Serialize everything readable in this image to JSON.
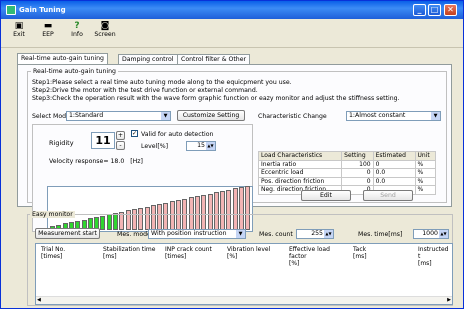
{
  "window": {
    "title": "Gain Tuning",
    "min": "_",
    "max": "□",
    "close": "✕"
  },
  "toolbar": [
    {
      "label": "Exit",
      "icon": "exit-icon"
    },
    {
      "label": "EEP",
      "icon": "eep-icon"
    },
    {
      "label": "Info",
      "icon": "help-icon"
    },
    {
      "label": "Screen",
      "icon": "camera-icon"
    }
  ],
  "tabs": [
    "Real-time auto-gain tuning",
    "Damping control",
    "Control filter & Other"
  ],
  "rt": {
    "group_title": "Real-time auto-gain tuning",
    "step1": "Step1:Please select a real time auto tuning mode along to the equicpment you use.",
    "step2": "Step2:Drive the motor with the test drive function or external command.",
    "step3": "Step3:Check the operation result with the wave form graphic function or eazy monitor and adjust the stiffness setting.",
    "select_mode_label": "Select Mode",
    "select_mode_value": "1:Standard",
    "customize_button": "Customize Setting",
    "char_change_label": "Characteristic Change",
    "char_change_value": "1:Almost constant",
    "rigidity_label": "Rigidity",
    "rigidity_value": "11",
    "plus": "+",
    "minus": "-",
    "valid_label": "Valid for auto detection",
    "level_label": "Level[%]",
    "level_value": "15",
    "velocity_label": "Velocity response=",
    "velocity_value": "18.0",
    "velocity_unit": "[Hz]",
    "edit_button": "Edit",
    "send_button": "Send"
  },
  "load_table": {
    "headers": [
      "Load Characteristics",
      "Setting",
      "Estimated",
      "Unit"
    ],
    "rows": [
      [
        "Inertia ratio",
        "100",
        "0",
        "%"
      ],
      [
        "Eccentric load",
        "0",
        "0.0",
        "%"
      ],
      [
        "Pos. direction friction",
        "0",
        "0.0",
        "%"
      ],
      [
        "Neg. direction friction",
        "0",
        "",
        "%"
      ]
    ]
  },
  "monitor": {
    "group_title": "Easy monitor",
    "measure_button": "Measurement start",
    "mes_mode_label": "Mes. mode",
    "mes_mode_value": "With position instruction",
    "mes_count_label": "Mes. count",
    "mes_count_value": "255",
    "mes_time_label": "Mes. time[ms]",
    "mes_time_value": "1000",
    "columns": [
      "Trial No.\n[times]",
      "Stabilization time\n[ms]",
      "INP crack count\n[times]",
      "Vibration level\n[%]",
      "Effective load factor\n[%]",
      "Tack\n[ms]",
      "Instructed t\n[ms]"
    ]
  },
  "rigidity_bars": {
    "count": 32,
    "active_count": 11,
    "active_color": "#2fd62f",
    "inactive_color": "#f3b4b4"
  }
}
